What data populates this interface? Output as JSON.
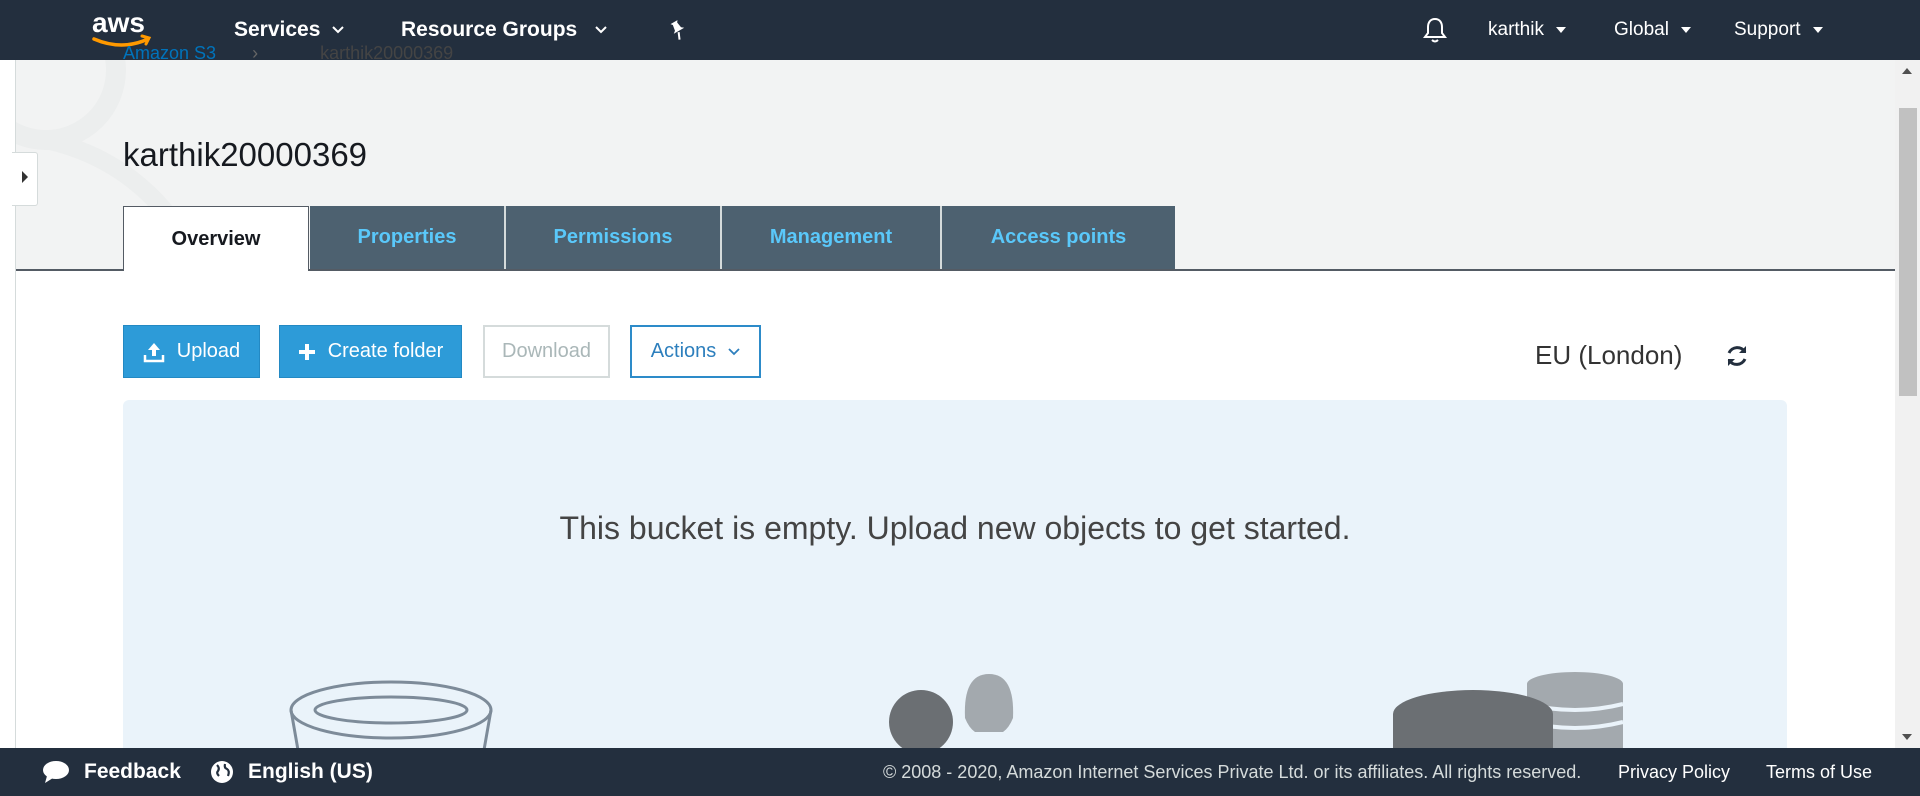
{
  "topnav": {
    "logo_text": "aws",
    "services_label": "Services",
    "resource_groups_label": "Resource Groups",
    "user_label": "karthik",
    "region_menu_label": "Global",
    "support_label": "Support",
    "bg_color": "#232f3e"
  },
  "breadcrumb": {
    "root": "Amazon S3",
    "current": "karthik20000369"
  },
  "bucket": {
    "name": "karthik20000369"
  },
  "tabs": [
    {
      "label": "Overview",
      "active": true
    },
    {
      "label": "Properties"
    },
    {
      "label": "Permissions"
    },
    {
      "label": "Management"
    },
    {
      "label": "Access points"
    }
  ],
  "actions": {
    "upload_label": "Upload",
    "create_folder_label": "Create folder",
    "download_label": "Download",
    "actions_label": "Actions",
    "primary_color": "#2d9bd8"
  },
  "region": {
    "label": "EU (London)"
  },
  "empty_state": {
    "message": "This bucket is empty. Upload new objects to get started.",
    "bg_color": "#eaf3fa"
  },
  "footer": {
    "feedback_label": "Feedback",
    "language_label": "English (US)",
    "copyright": "© 2008 - 2020, Amazon Internet Services Private Ltd. or its affiliates. All rights reserved.",
    "privacy_label": "Privacy Policy",
    "terms_label": "Terms of Use"
  },
  "icons": [
    "aws-logo",
    "chevron-down-icon",
    "pin-icon",
    "bell-icon",
    "caret-down-icon",
    "expand-arrow-icon",
    "upload-icon",
    "plus-icon",
    "refresh-icon",
    "speech-bubble-icon",
    "globe-icon"
  ]
}
